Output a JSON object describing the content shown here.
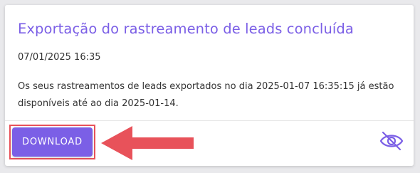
{
  "notification": {
    "title": "Exportação do rastreamento de leads concluída",
    "timestamp": "07/01/2025 16:35",
    "message": "Os seus rastreamentos de leads exportados no dia 2025-01-07 16:35:15 já estão disponíveis até ao dia 2025-01-14.",
    "download_label": "DOWNLOAD",
    "hide_icon": "eye-off-icon"
  },
  "colors": {
    "accent": "#7b5fe6",
    "highlight": "#e8525a",
    "text": "#333333"
  }
}
